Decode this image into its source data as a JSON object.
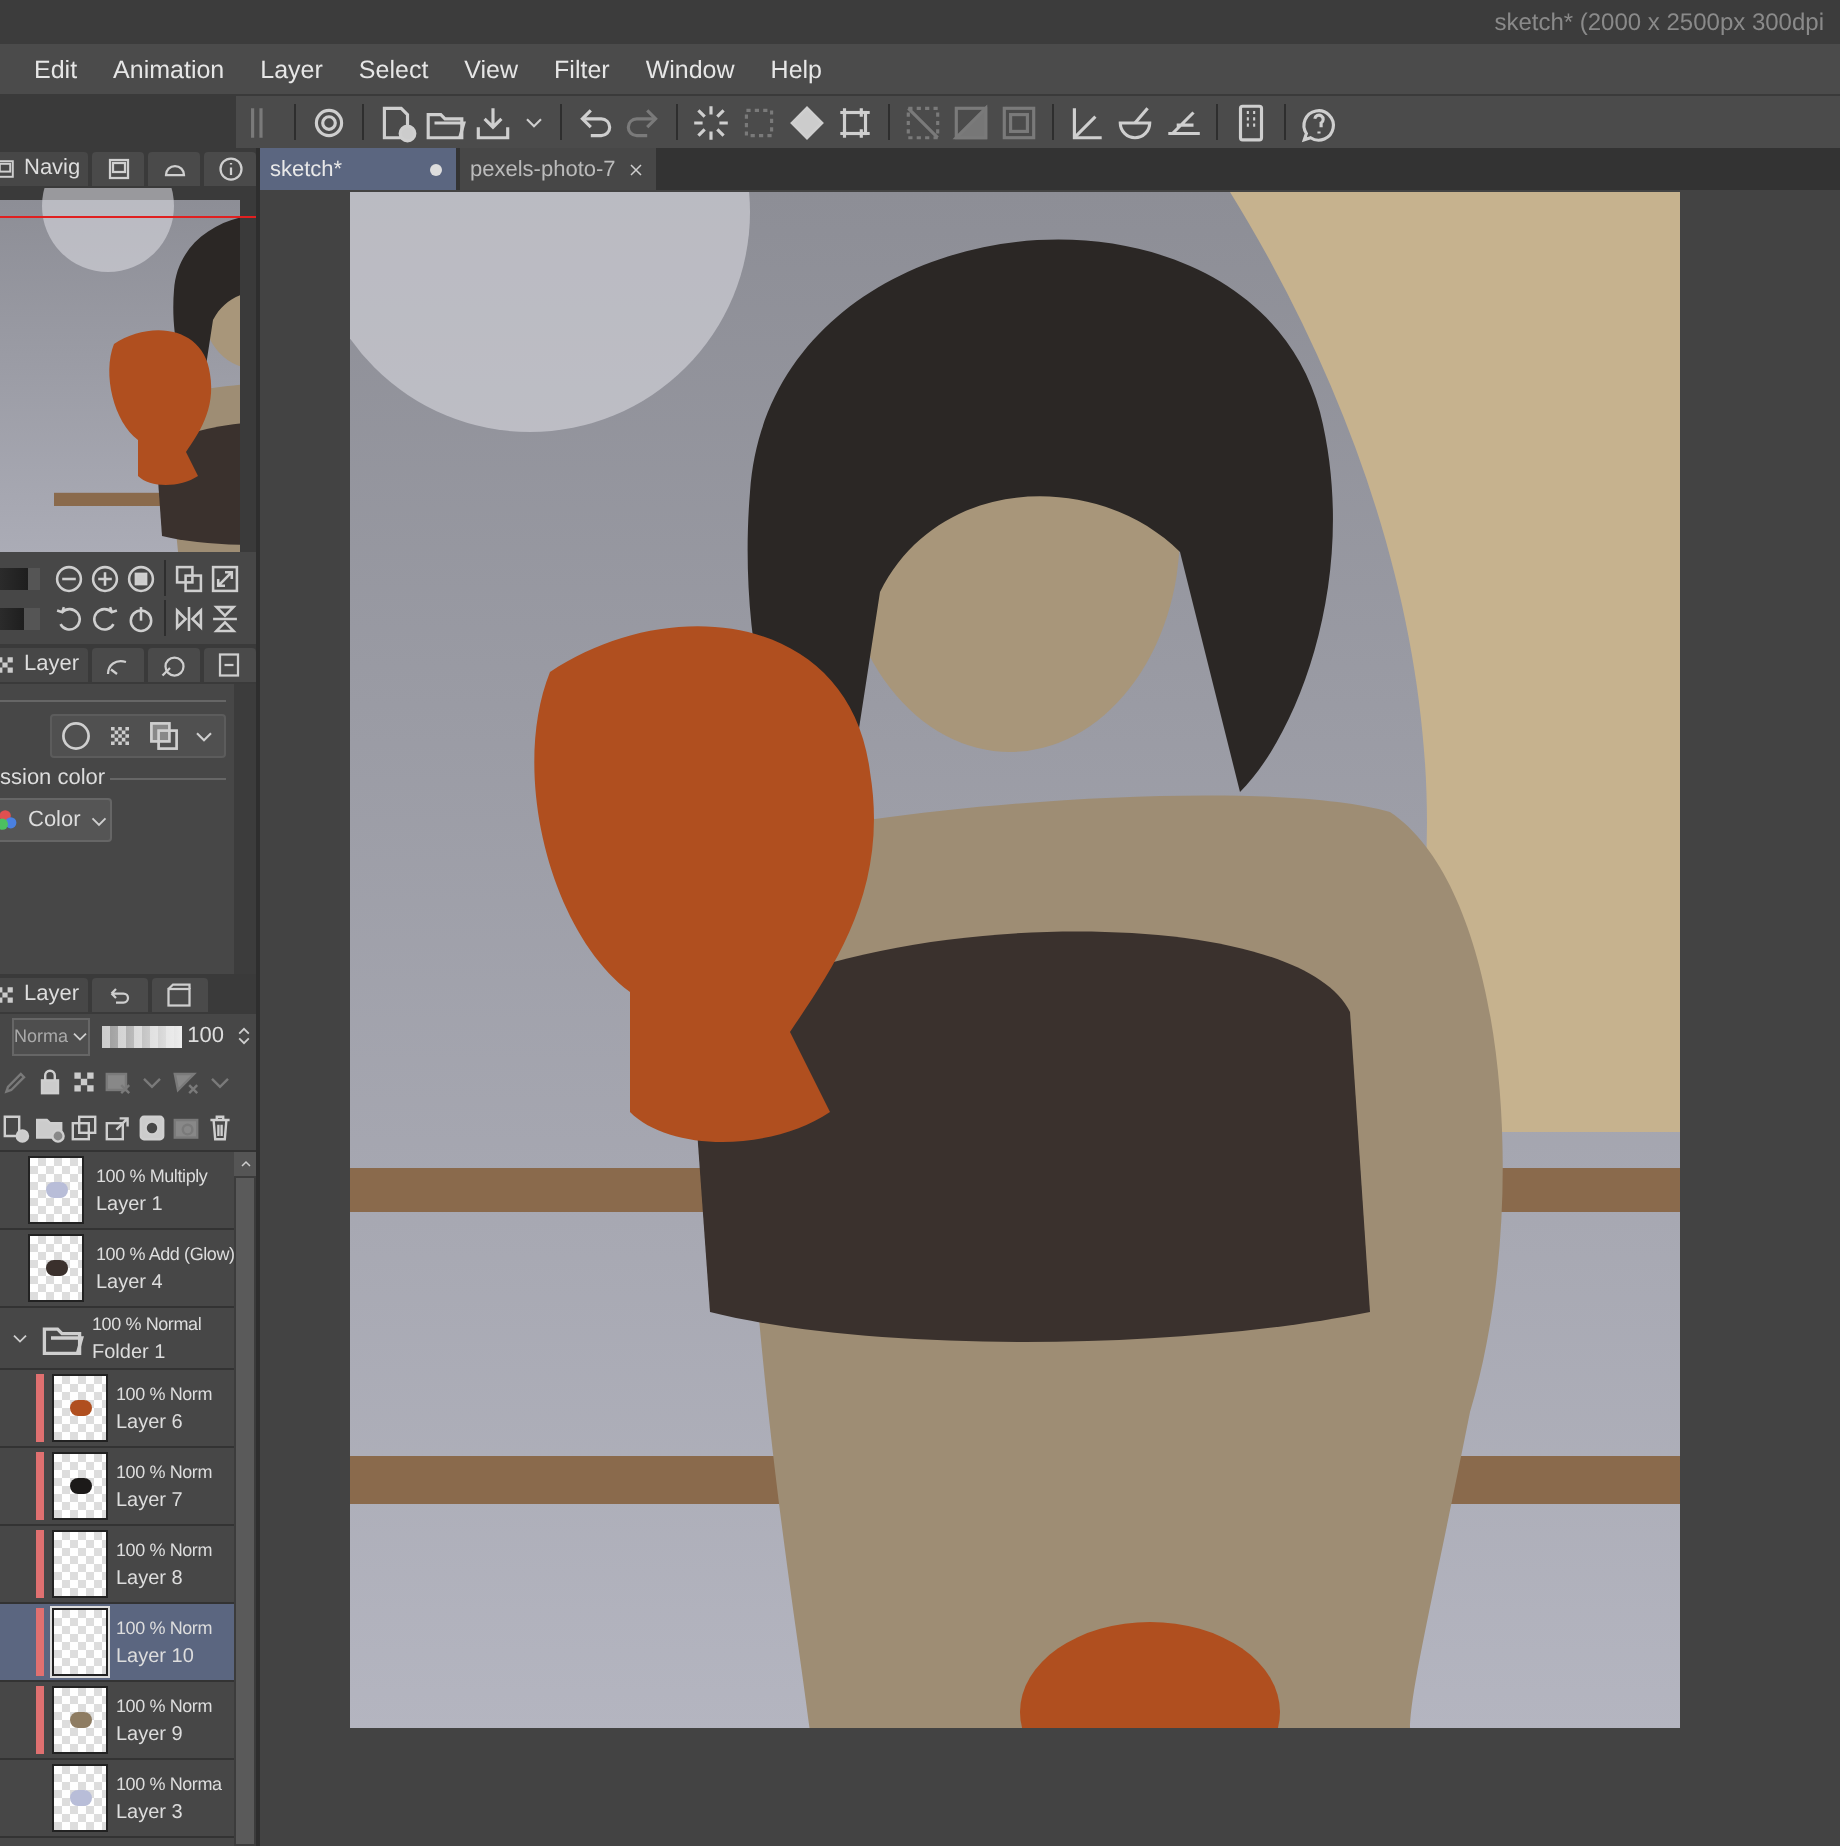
{
  "window": {
    "title": "sketch* (2000 x 2500px 300dpi"
  },
  "menu": [
    "Edit",
    "Animation",
    "Layer",
    "Select",
    "View",
    "Filter",
    "Window",
    "Help"
  ],
  "navigator": {
    "tab": "Navig",
    "zoom_slider": {
      "level": 0.7
    },
    "rotate_slider": {
      "level": 0.6
    }
  },
  "property_panel": {
    "tab": "Layer",
    "section": "ssion color",
    "color_mode": "Color"
  },
  "layer_panel": {
    "tab": "Layer",
    "blend_mode": "Norma",
    "opacity": "100",
    "opacity_slider": {
      "level": 1
    },
    "layers": [
      {
        "kind": "layer",
        "mode": "100 % Multiply",
        "name": "Layer 1",
        "selected": false,
        "label_bar": false
      },
      {
        "kind": "layer",
        "mode": "100 % Add (Glow)",
        "name": "Layer 4",
        "selected": false,
        "label_bar": false
      },
      {
        "kind": "folder",
        "mode": "100 % Normal",
        "name": "Folder 1",
        "selected": false,
        "expanded": true,
        "children": [
          {
            "kind": "layer",
            "mode": "100 % Norm",
            "name": "Layer 6",
            "selected": false,
            "label_bar": true
          },
          {
            "kind": "layer",
            "mode": "100 % Norm",
            "name": "Layer 7",
            "selected": false,
            "label_bar": true
          },
          {
            "kind": "layer",
            "mode": "100 % Norm",
            "name": "Layer 8",
            "selected": false,
            "label_bar": true
          },
          {
            "kind": "layer",
            "mode": "100 % Norm",
            "name": "Layer 10",
            "selected": true,
            "label_bar": true
          },
          {
            "kind": "layer",
            "mode": "100 % Norm",
            "name": "Layer 9",
            "selected": false,
            "label_bar": true
          },
          {
            "kind": "layer",
            "mode": "100 % Norma",
            "name": "Layer 3",
            "selected": false,
            "label_bar": false
          }
        ]
      }
    ]
  },
  "canvas_tabs": [
    {
      "label": "sketch*",
      "selected": true,
      "modified": true
    },
    {
      "label": "pexels-photo-7",
      "selected": false,
      "modified": false
    }
  ]
}
